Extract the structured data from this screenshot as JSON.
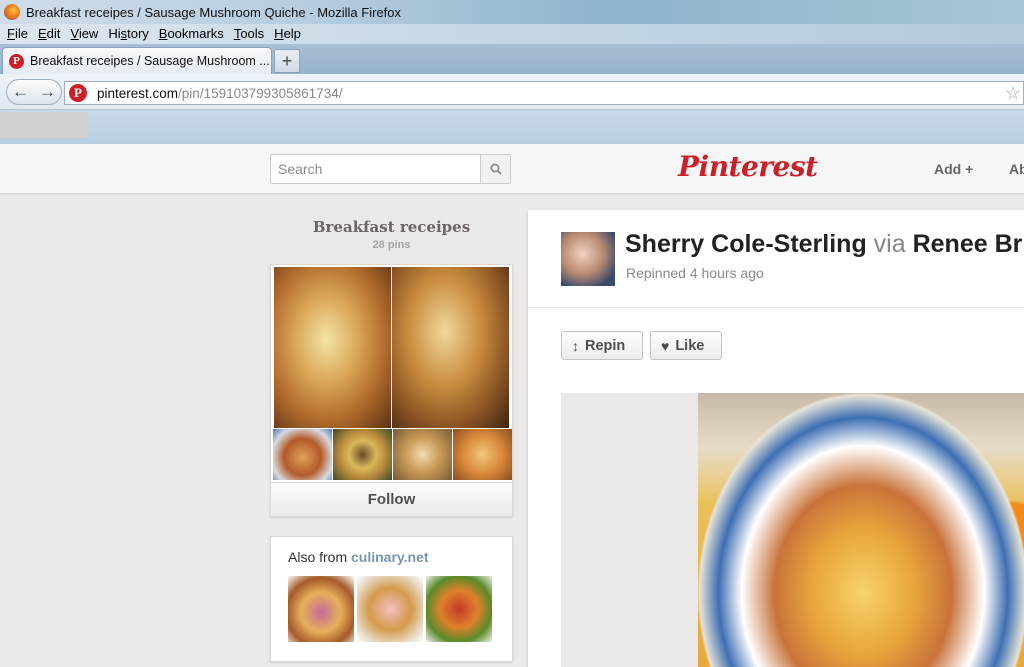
{
  "window": {
    "title": "Breakfast receipes / Sausage Mushroom Quiche - Mozilla Firefox"
  },
  "menu": [
    {
      "pre": "",
      "key": "F",
      "post": "ile"
    },
    {
      "pre": "",
      "key": "E",
      "post": "dit"
    },
    {
      "pre": "",
      "key": "V",
      "post": "iew"
    },
    {
      "pre": "Hi",
      "key": "s",
      "post": "tory"
    },
    {
      "pre": "",
      "key": "B",
      "post": "ookmarks"
    },
    {
      "pre": "",
      "key": "T",
      "post": "ools"
    },
    {
      "pre": "",
      "key": "H",
      "post": "elp"
    }
  ],
  "tab": {
    "label": "Breakfast receipes / Sausage Mushroom ...",
    "new_tab": "+"
  },
  "address": {
    "host": "pinterest.com",
    "path": "/pin/159103799305861734/"
  },
  "header": {
    "search_placeholder": "Search",
    "logo": "Pinterest",
    "add": "Add +",
    "about": "Ab"
  },
  "board": {
    "title": "Breakfast receipes",
    "pins": "28 pins",
    "follow": "Follow"
  },
  "also_from": {
    "prefix": "Also from ",
    "source": "culinary.net"
  },
  "pin": {
    "pinner": "Sherry Cole-Sterling",
    "via": " via ",
    "via_user": "Renee Br",
    "repinned": "Repinned 4 hours ago",
    "repin": "Repin",
    "like": "Like"
  }
}
